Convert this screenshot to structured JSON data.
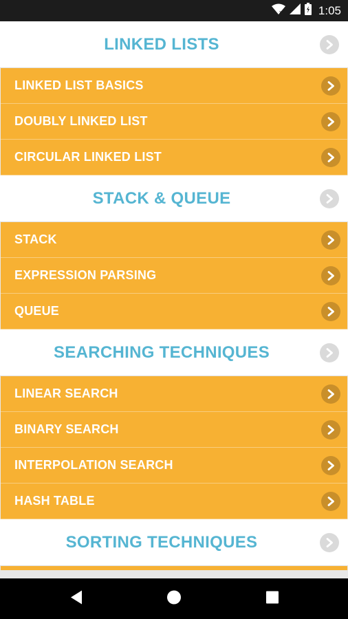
{
  "status_bar": {
    "time": "1:05",
    "icons": [
      "wifi-icon",
      "cell-signal-icon",
      "battery-icon"
    ]
  },
  "sections": [
    {
      "title": "LINKED LISTS",
      "items": [
        "LINKED LIST BASICS",
        "DOUBLY LINKED LIST",
        "CIRCULAR LINKED LIST"
      ]
    },
    {
      "title": "STACK & QUEUE",
      "items": [
        "STACK",
        "EXPRESSION PARSING",
        "QUEUE"
      ]
    },
    {
      "title": "SEARCHING TECHNIQUES",
      "items": [
        "LINEAR SEARCH",
        "BINARY SEARCH",
        "INTERPOLATION SEARCH",
        "HASH TABLE"
      ]
    },
    {
      "title": "SORTING TECHNIQUES",
      "items": []
    }
  ],
  "nav_bar": {
    "buttons": [
      "back-icon",
      "home-icon",
      "recents-icon"
    ]
  },
  "colors": {
    "header_text": "#55b5d2",
    "item_background": "#f7b133",
    "item_text": "#ffffff",
    "header_chevron": "#dadada",
    "item_chevron": "#c98f2a"
  }
}
